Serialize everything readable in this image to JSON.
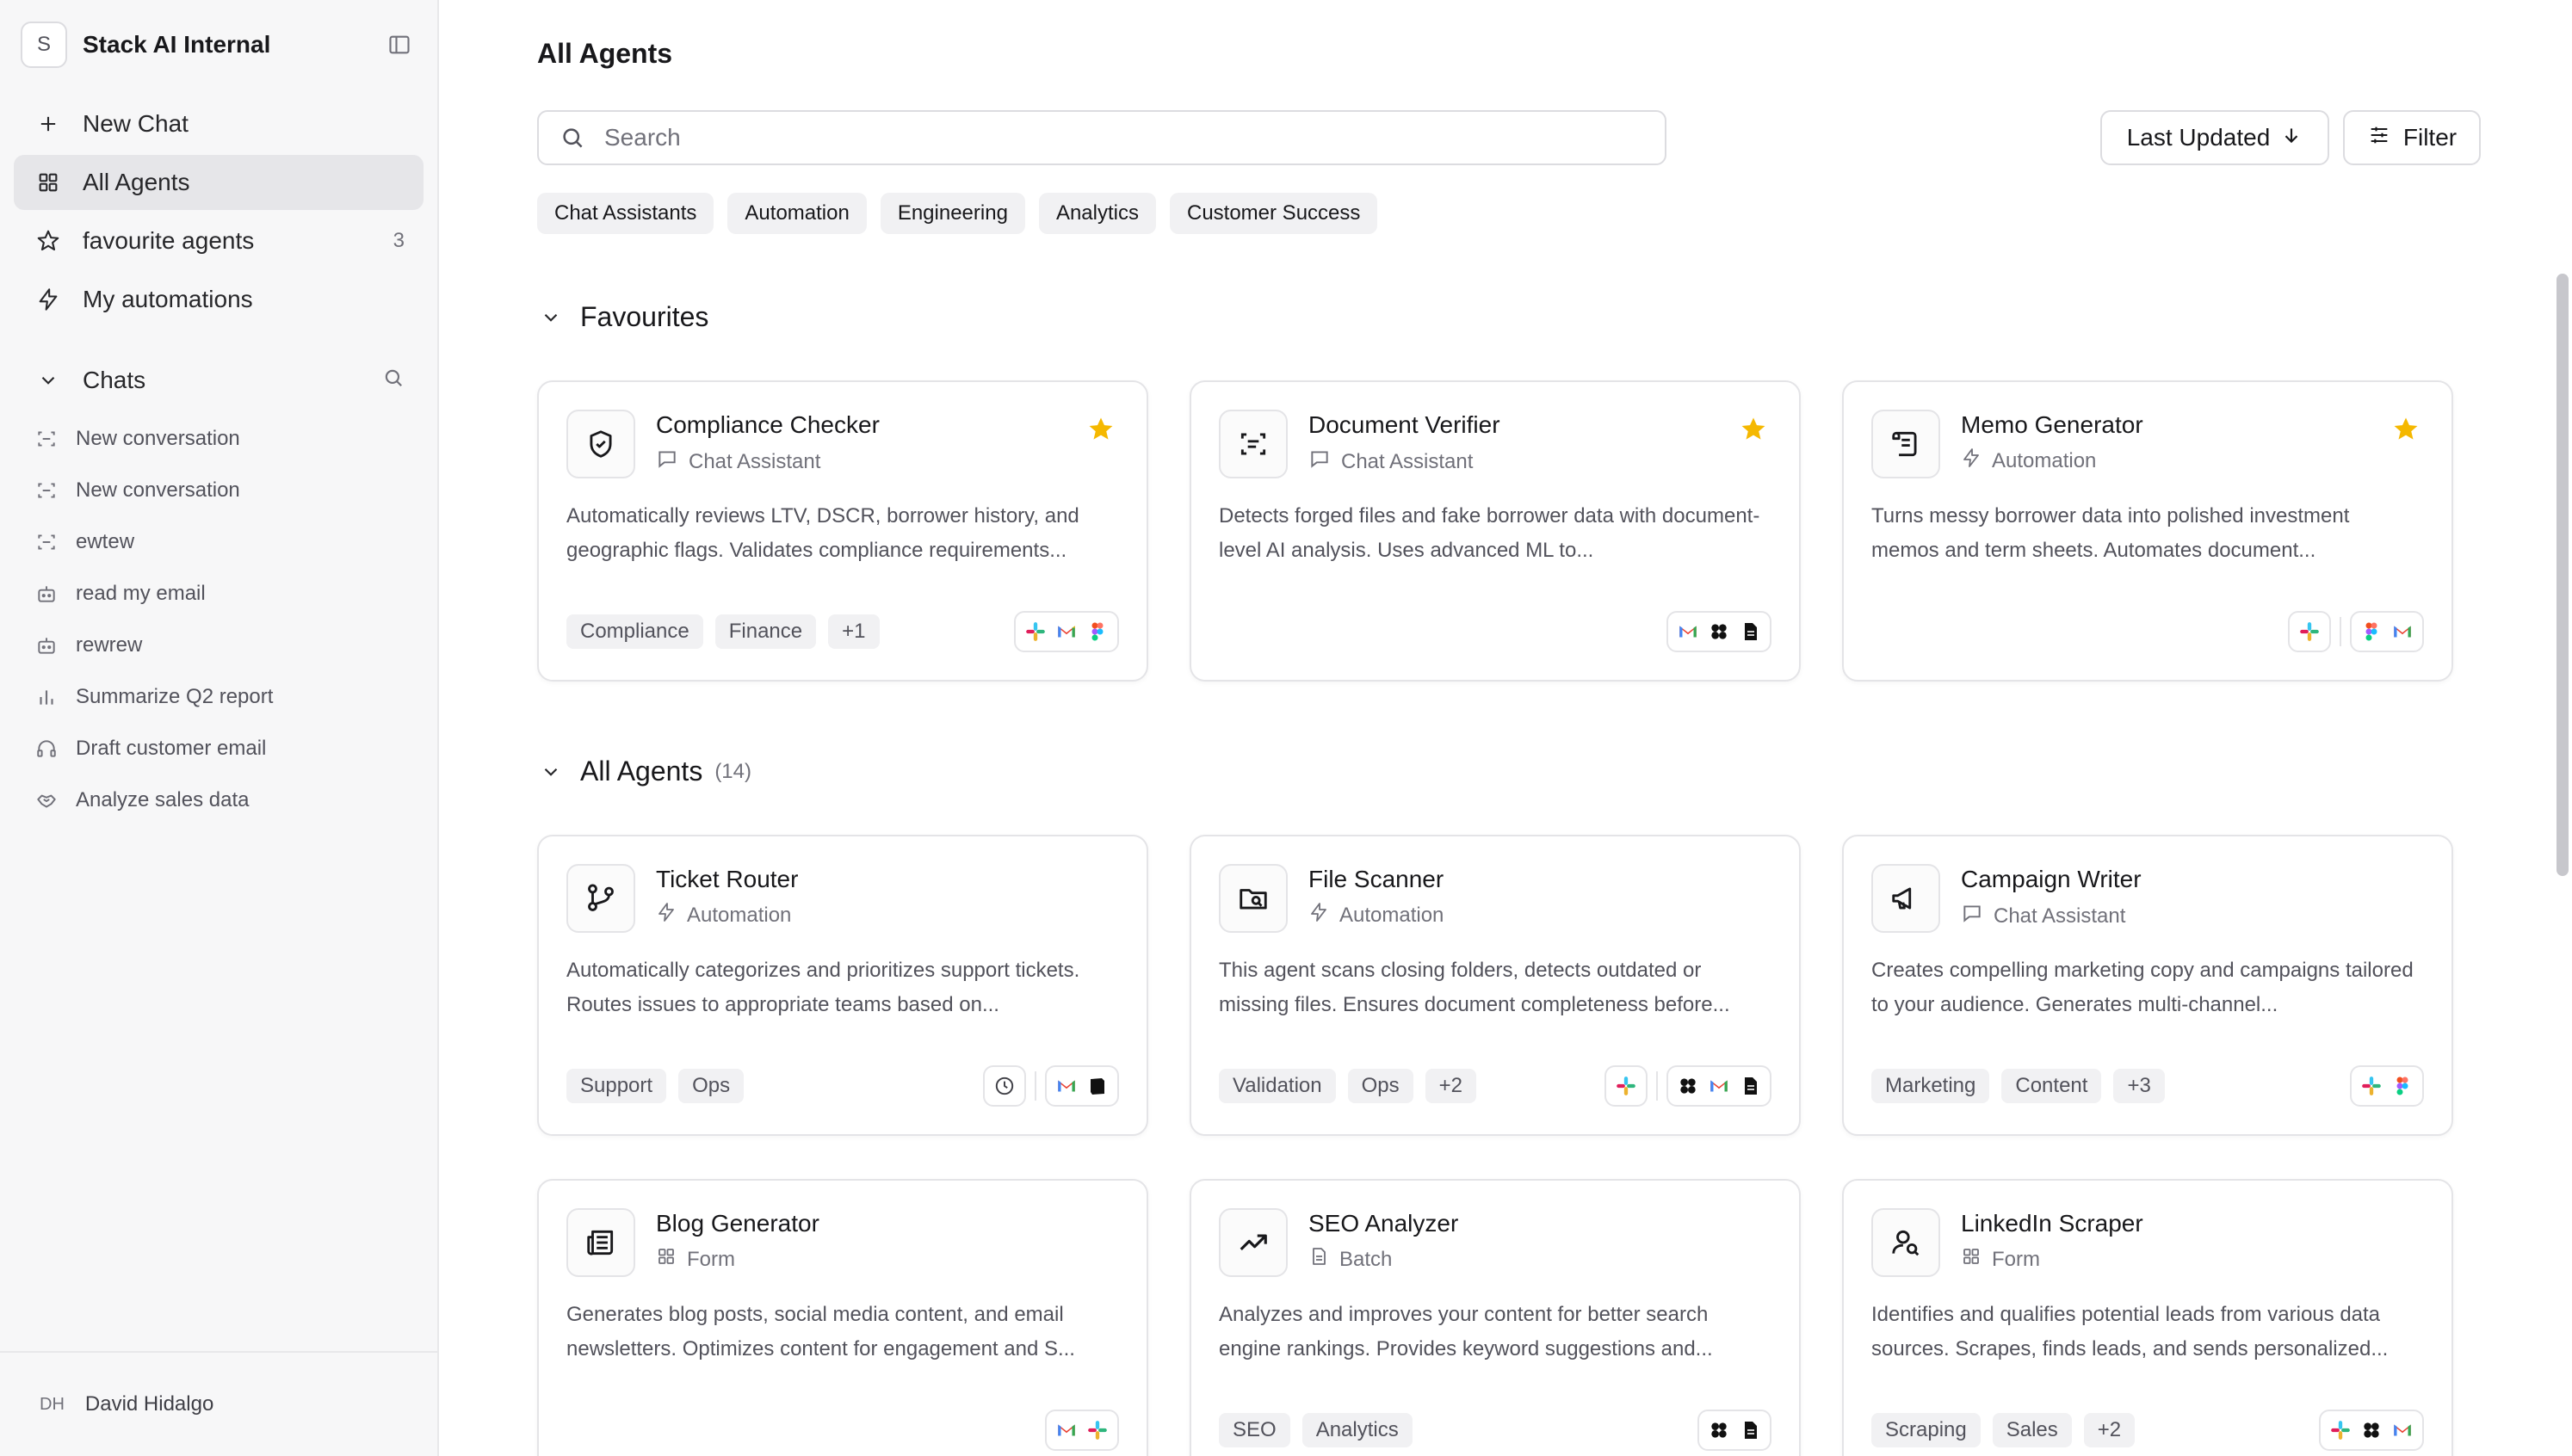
{
  "workspace": {
    "badge": "S",
    "name": "Stack AI Internal"
  },
  "nav": {
    "new_chat": "New Chat",
    "all_agents": "All Agents",
    "favourites": "favourite agents",
    "favourites_count": "3",
    "automations": "My automations"
  },
  "chats": {
    "heading": "Chats",
    "items": [
      {
        "label": "New conversation",
        "icon": "scan-icon"
      },
      {
        "label": "New conversation",
        "icon": "scan-icon"
      },
      {
        "label": "ewtew",
        "icon": "scan-icon"
      },
      {
        "label": "read my email",
        "icon": "bot-icon"
      },
      {
        "label": "rewrew",
        "icon": "bot-icon"
      },
      {
        "label": "Summarize Q2 report",
        "icon": "bar-chart-icon"
      },
      {
        "label": "Draft customer email",
        "icon": "headset-icon"
      },
      {
        "label": "Analyze sales data",
        "icon": "handshake-icon"
      }
    ]
  },
  "user": {
    "initials": "DH",
    "name": "David Hidalgo"
  },
  "main": {
    "title": "All Agents",
    "search_placeholder": "Search",
    "sort_label": "Last Updated",
    "filter_label": "Filter",
    "categories": [
      "Chat Assistants",
      "Automation",
      "Engineering",
      "Analytics",
      "Customer Success"
    ],
    "favourites_heading": "Favourites",
    "all_heading": "All Agents",
    "all_count": "(14)"
  },
  "favourites": [
    {
      "name": "Compliance Checker",
      "type": "Chat Assistant",
      "desc": "Automatically reviews LTV, DSCR, borrower history, and geographic flags. Validates compliance requirements...",
      "tags": [
        "Compliance",
        "Finance",
        "+1"
      ]
    },
    {
      "name": "Document Verifier",
      "type": "Chat Assistant",
      "desc": "Detects forged files and fake borrower data with document-level AI analysis. Uses advanced ML to...",
      "tags": []
    },
    {
      "name": "Memo Generator",
      "type": "Automation",
      "desc": "Turns messy borrower data into polished investment memos and term sheets. Automates document...",
      "tags": []
    }
  ],
  "agents": [
    {
      "name": "Ticket Router",
      "type": "Automation",
      "desc": "Automatically categorizes and prioritizes support tickets. Routes issues to appropriate teams based on...",
      "tags": [
        "Support",
        "Ops"
      ]
    },
    {
      "name": "File Scanner",
      "type": "Automation",
      "desc": "This agent scans closing folders, detects outdated or missing files. Ensures document completeness before...",
      "tags": [
        "Validation",
        "Ops",
        "+2"
      ]
    },
    {
      "name": "Campaign Writer",
      "type": "Chat Assistant",
      "desc": "Creates compelling marketing copy and campaigns tailored to your audience. Generates multi-channel...",
      "tags": [
        "Marketing",
        "Content",
        "+3"
      ]
    },
    {
      "name": "Blog Generator",
      "type": "Form",
      "desc": "Generates blog posts, social media content, and email newsletters. Optimizes content for engagement and S...",
      "tags": []
    },
    {
      "name": "SEO Analyzer",
      "type": "Batch",
      "desc": "Analyzes and improves your content for better search engine rankings. Provides keyword suggestions and...",
      "tags": [
        "SEO",
        "Analytics"
      ]
    },
    {
      "name": "LinkedIn Scraper",
      "type": "Form",
      "desc": "Identifies and qualifies potential leads from various data sources. Scrapes, finds leads, and sends personalized...",
      "tags": [
        "Scraping",
        "Sales",
        "+2"
      ]
    }
  ],
  "colors": {
    "star": "#f5b800",
    "accent": "#18181b",
    "muted": "#71717a"
  }
}
